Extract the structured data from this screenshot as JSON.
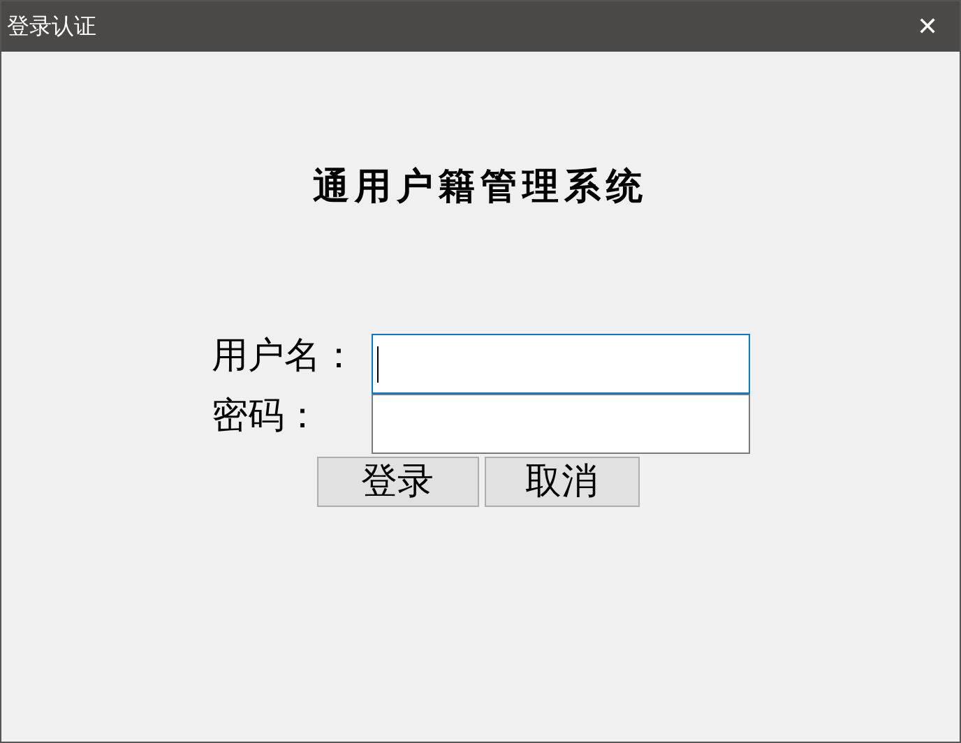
{
  "window": {
    "title": "登录认证",
    "close": "✕"
  },
  "heading": "通用户籍管理系统",
  "fields": [
    {
      "label": "用户名：",
      "focused": true
    },
    {
      "label": "密码：",
      "focused": false
    }
  ],
  "buttons": [
    "登录",
    "取消"
  ]
}
